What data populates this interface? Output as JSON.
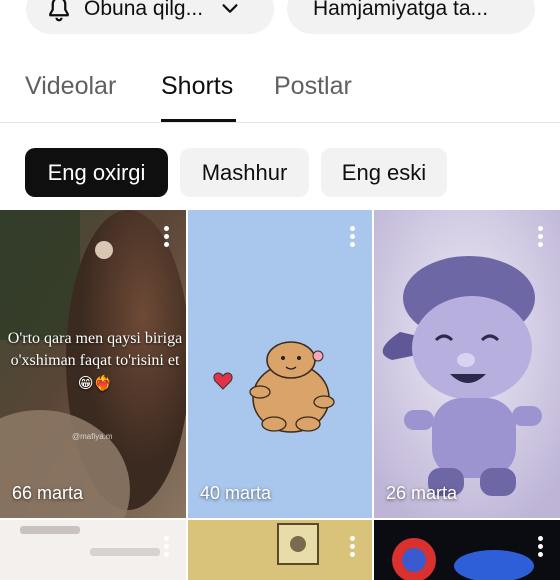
{
  "header": {
    "subscribe_label": "Obuna qilg...",
    "community_label": "Hamjamiyatga ta..."
  },
  "tabs": [
    {
      "label": "Videolar"
    },
    {
      "label": "Shorts"
    },
    {
      "label": "Postlar"
    }
  ],
  "filters": [
    {
      "label": "Eng oxirgi"
    },
    {
      "label": "Mashhur"
    },
    {
      "label": "Eng eski"
    }
  ],
  "shorts": [
    {
      "views": "66 marta",
      "caption": "O'rto qara men qaysi biriga o'xshiman faqat to'risini et",
      "caption_emoji": "😁❤️‍🔥",
      "watermark": "@mafiya.m"
    },
    {
      "views": "40 marta"
    },
    {
      "views": "26 marta"
    }
  ],
  "colors": {
    "accent": "#0f0f0f",
    "chip_bg": "#f2f2f2",
    "muted_text": "#606060"
  }
}
